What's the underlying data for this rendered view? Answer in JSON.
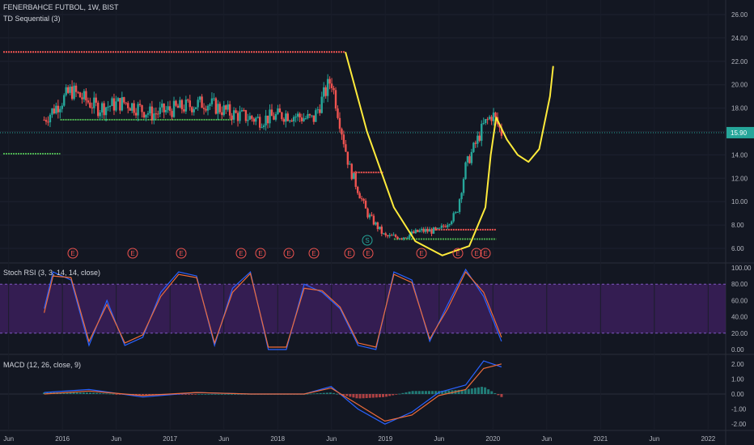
{
  "header": {
    "symbol_line": "FENERBAHCE FUTBOL, 1W, BIST",
    "indicator_td": "TD Sequential (3)"
  },
  "panes": {
    "rsi_label": "Stoch RSI (3, 3, 14, 14, close)",
    "macd_label": "MACD (12, 26, close, 9)"
  },
  "price": {
    "current_label": "15.90",
    "current": 15.9,
    "ticks": [
      6,
      8,
      10,
      12,
      14,
      16,
      18,
      20,
      22,
      24,
      26
    ],
    "tick_labels": [
      "6.00",
      "8.00",
      "10.00",
      "12.00",
      "14.00",
      "16.00",
      "18.00",
      "20.00",
      "22.00",
      "24.00",
      "26.00"
    ]
  },
  "rsi_axis": {
    "ticks": [
      0,
      20,
      40,
      60,
      80,
      100
    ],
    "tick_labels": [
      "0.00",
      "20.00",
      "40.00",
      "60.00",
      "80.00",
      "100.00"
    ]
  },
  "macd_axis": {
    "ticks": [
      -2,
      -1,
      0,
      1,
      2
    ],
    "tick_labels": [
      "-2.00",
      "-1.00",
      "0.00",
      "1.00",
      "2.00"
    ]
  },
  "time_axis": {
    "labels": [
      "Jun",
      "2016",
      "Jun",
      "2017",
      "Jun",
      "2018",
      "Jun",
      "2019",
      "Jun",
      "2020",
      "Jun",
      "2021",
      "Jun",
      "2022"
    ]
  },
  "events": [
    "E",
    "E",
    "E",
    "E",
    "E",
    "E",
    "E",
    "E",
    "E",
    "E",
    "E",
    "E",
    "E"
  ],
  "special_marker": "S",
  "colors": {
    "background": "#131722",
    "up": "#26a69a",
    "down": "#ef5350",
    "drawing": "#ffeb3b",
    "rsi_band": "#3b1e5a",
    "k_line": "#2962ff",
    "d_line": "#ef6c3a",
    "price_line": "#26a69a"
  },
  "chart_data": [
    {
      "type": "line",
      "title": "FENERBAHCE FUTBOL, 1W, BIST",
      "x": [
        "2015-10",
        "2016-01",
        "2016-04",
        "2016-07",
        "2016-10",
        "2017-01",
        "2017-04",
        "2017-07",
        "2017-10",
        "2018-01",
        "2018-04",
        "2018-06",
        "2018-08",
        "2018-10",
        "2018-12",
        "2019-02",
        "2019-04",
        "2019-06",
        "2019-08",
        "2019-09",
        "2019-11",
        "2019-12",
        "2020-01"
      ],
      "series": [
        {
          "values": [
            17.0,
            19.5,
            18.0,
            18.5,
            17.5,
            18.0,
            18.5,
            17.5,
            17.0,
            17.5,
            17.0,
            20.5,
            13.0,
            9.0,
            7.0,
            7.0,
            7.5,
            7.5,
            9.0,
            13.0,
            16.5,
            17.5,
            15.9
          ]
        }
      ],
      "ylim": [
        5,
        27
      ],
      "resistance": [
        22.8,
        7.6,
        12.5
      ],
      "support": [
        14.1,
        17.0,
        6.8
      ]
    },
    {
      "type": "line",
      "title": "Stoch RSI (3, 3, 14, 14, close)",
      "x": [
        "2015-10",
        "2015-11",
        "2016-01",
        "2016-03",
        "2016-05",
        "2016-07",
        "2016-09",
        "2016-11",
        "2017-01",
        "2017-03",
        "2017-05",
        "2017-07",
        "2017-09",
        "2017-11",
        "2018-01",
        "2018-03",
        "2018-05",
        "2018-07",
        "2018-09",
        "2018-11",
        "2019-01",
        "2019-03",
        "2019-05",
        "2019-07",
        "2019-09",
        "2019-11",
        "2020-01"
      ],
      "series": [
        {
          "values": [
            50,
            95,
            85,
            5,
            60,
            5,
            15,
            70,
            95,
            90,
            5,
            75,
            95,
            0,
            0,
            80,
            70,
            50,
            5,
            0,
            95,
            85,
            10,
            55,
            98,
            65,
            10
          ]
        },
        {
          "values": [
            45,
            90,
            88,
            10,
            55,
            8,
            18,
            65,
            92,
            88,
            8,
            70,
            93,
            3,
            3,
            75,
            72,
            52,
            8,
            3,
            92,
            82,
            13,
            50,
            95,
            70,
            15
          ]
        }
      ],
      "ylim": [
        0,
        100
      ],
      "bands": [
        20,
        80
      ]
    },
    {
      "type": "line",
      "title": "MACD (12, 26, close, 9)",
      "x": [
        "2015-10",
        "2016-03",
        "2016-09",
        "2017-03",
        "2017-09",
        "2018-03",
        "2018-06",
        "2018-09",
        "2018-12",
        "2019-03",
        "2019-06",
        "2019-09",
        "2019-11",
        "2020-01"
      ],
      "series": [
        {
          "values": [
            0.1,
            0.3,
            -0.2,
            0.1,
            0.0,
            0.0,
            0.5,
            -1.0,
            -2.0,
            -1.2,
            0.1,
            0.6,
            2.2,
            1.8
          ]
        },
        {
          "values": [
            0.0,
            0.2,
            -0.1,
            0.1,
            0.0,
            0.0,
            0.4,
            -0.7,
            -1.8,
            -1.4,
            -0.1,
            0.3,
            1.7,
            2.0
          ]
        }
      ],
      "ylim": [
        -2.2,
        2.6
      ]
    }
  ]
}
